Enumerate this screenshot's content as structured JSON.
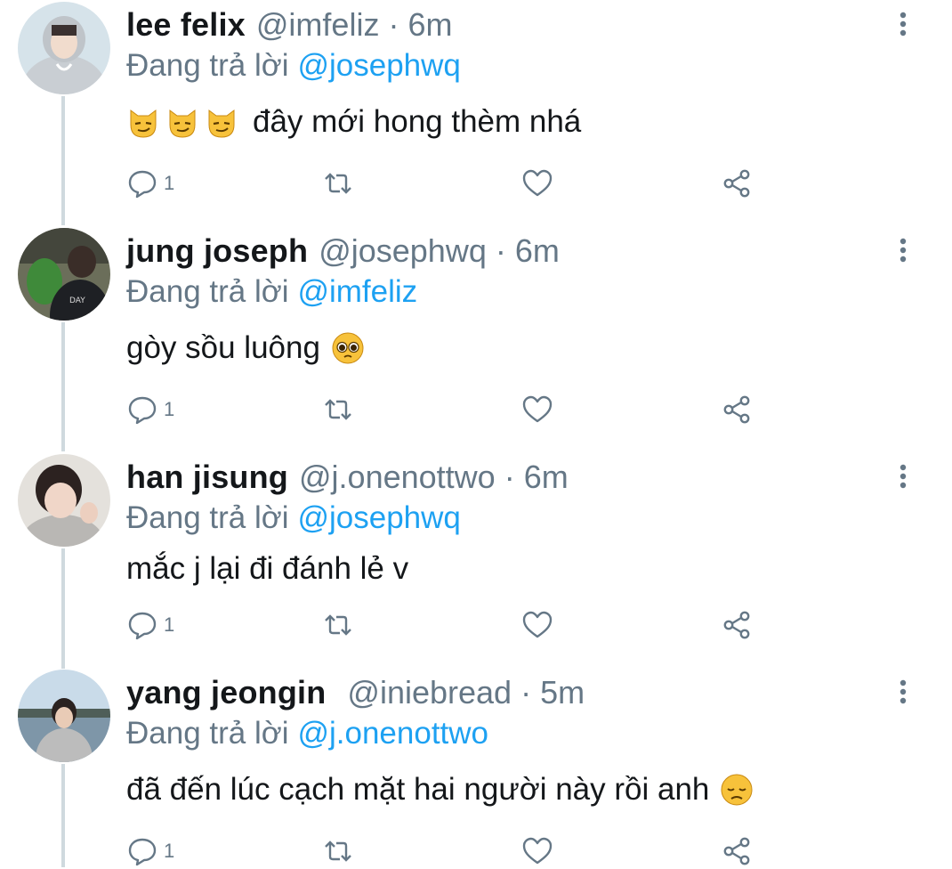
{
  "thread": {
    "reply_label": "Đang trả lời",
    "tweets": [
      {
        "name": "lee felix",
        "handle": "@imfeliz",
        "separator": "·",
        "time": "6m",
        "reply_to": "@josephwq",
        "text": "đây mới hong thèm nhá",
        "emojis": [
          "smirking-cat-emoji",
          "smirking-cat-emoji",
          "smirking-cat-emoji"
        ],
        "emoji_position": "before",
        "reply_count": "1"
      },
      {
        "name": "jung joseph",
        "handle": "@josephwq",
        "separator": "·",
        "time": "6m",
        "reply_to": "@imfeliz",
        "text": "gòy sồu luông",
        "emojis": [
          "pleading-face-emoji"
        ],
        "emoji_position": "after",
        "reply_count": "1"
      },
      {
        "name": "han jisung",
        "handle": "@j.onenottwo",
        "separator": "·",
        "time": "6m",
        "reply_to": "@josephwq",
        "text": "mắc j lại đi đánh lẻ v",
        "emojis": [],
        "emoji_position": "none",
        "reply_count": "1"
      },
      {
        "name": "yang jeongin",
        "handle": "@iniebread",
        "separator": "·",
        "time": "5m",
        "reply_to": "@j.onenottwo",
        "text": "đã đến lúc cạch mặt hai người này rồi anh",
        "emojis": [
          "disappointed-face-emoji"
        ],
        "emoji_position": "after",
        "reply_count": "1"
      }
    ]
  },
  "icons": {
    "reply": "reply-icon",
    "retweet": "retweet-icon",
    "like": "heart-icon",
    "share": "share-icon",
    "more": "more-vertical-icon"
  },
  "colors": {
    "link": "#1da1f2",
    "secondary_text": "#657786",
    "primary_text": "#14171a",
    "thread_line": "#cfd9de"
  }
}
